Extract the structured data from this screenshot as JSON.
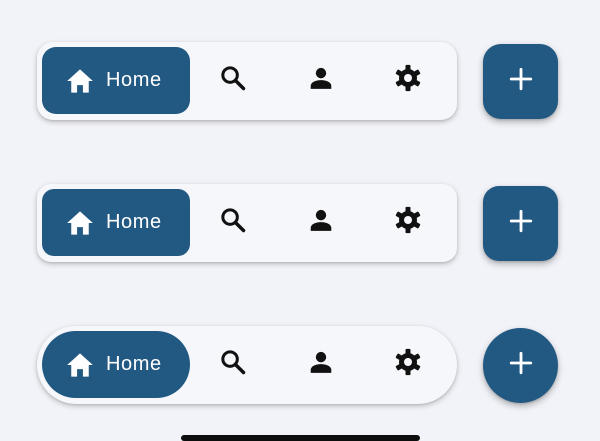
{
  "colors": {
    "accent": "#225983",
    "background": "#f2f3f8",
    "bar_surface": "#f6f7fb",
    "icon": "#111111",
    "on_accent": "#ffffff"
  },
  "variants": [
    {
      "shape": "rounded",
      "home": {
        "label": "Home",
        "icon": "home-icon"
      },
      "items": [
        {
          "icon": "search-icon"
        },
        {
          "icon": "person-icon"
        },
        {
          "icon": "gear-icon"
        }
      ],
      "fab": {
        "icon": "plus-icon"
      }
    },
    {
      "shape": "rounded-small",
      "home": {
        "label": "Home",
        "icon": "home-icon"
      },
      "items": [
        {
          "icon": "search-icon"
        },
        {
          "icon": "person-icon"
        },
        {
          "icon": "gear-icon"
        }
      ],
      "fab": {
        "icon": "plus-icon"
      }
    },
    {
      "shape": "pill",
      "home": {
        "label": "Home",
        "icon": "home-icon"
      },
      "items": [
        {
          "icon": "search-icon"
        },
        {
          "icon": "person-icon"
        },
        {
          "icon": "gear-icon"
        }
      ],
      "fab": {
        "icon": "plus-icon"
      }
    }
  ]
}
